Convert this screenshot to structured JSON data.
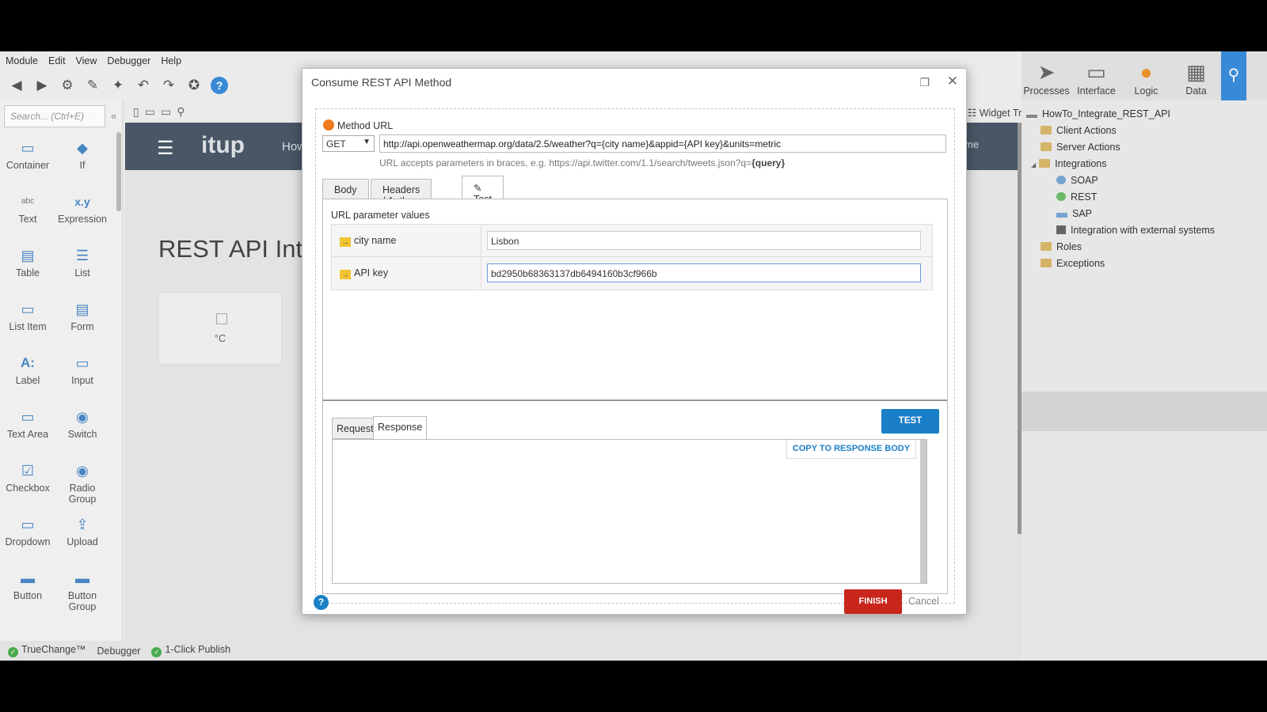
{
  "menu": [
    "Module",
    "Edit",
    "View",
    "Debugger",
    "Help"
  ],
  "main_tabs": [
    {
      "label": "Processes",
      "icon": "processes-icon"
    },
    {
      "label": "Interface",
      "icon": "interface-icon"
    },
    {
      "label": "Logic",
      "icon": "logic-icon"
    },
    {
      "label": "Data",
      "icon": "data-icon"
    }
  ],
  "toolbox": {
    "search_placeholder": "Search... (Ctrl+E)",
    "widgets": [
      "Container",
      "If",
      "Text",
      "Expression",
      "Table",
      "List",
      "List Item",
      "Form",
      "Label",
      "Input",
      "Text Area",
      "Switch",
      "Checkbox",
      "Radio Group",
      "Dropdown",
      "Upload",
      "Button",
      "Button Group"
    ],
    "widget_glyphs": [
      "abc",
      "x.y",
      "A:"
    ]
  },
  "canvas": {
    "widget_tree_label": "Widget Tree",
    "app_logo": "itup",
    "header_fragment": "How",
    "header_right": "me",
    "page_title": "REST API Int",
    "card_unit": "°C"
  },
  "tree": {
    "root": "HowTo_Integrate_REST_API",
    "items": [
      "Client Actions",
      "Server Actions",
      "Integrations",
      "SOAP",
      "REST",
      "SAP",
      "Integration with external systems",
      "Roles",
      "Exceptions"
    ]
  },
  "statusbar": [
    "TrueChange™",
    "Debugger",
    "1-Click Publish"
  ],
  "dialog": {
    "title": "Consume REST API Method",
    "method_url_label": "Method URL",
    "verb": "GET",
    "url": "http://api.openweathermap.org/data/2.5/weather?q={city name}&appid={API key}&units=metric",
    "url_hint": "URL accepts parameters in braces, e.g. https://api.twitter.com/1.1/search/tweets.json?q=",
    "url_hint_bold": "{query}",
    "tabs": [
      "Body",
      "Headers / Auth",
      "Test"
    ],
    "param_section_label": "URL parameter values",
    "params": [
      {
        "name": "city name",
        "value": "Lisbon"
      },
      {
        "name": "API key",
        "value": "bd2950b68363137db6494160b3cf966b"
      }
    ],
    "test_button": "TEST",
    "response_tabs": [
      "Request",
      "Response"
    ],
    "copy_button": "COPY TO RESPONSE BODY",
    "finish_button": "FINISH",
    "cancel_button": "Cancel"
  },
  "colors": {
    "accent": "#1a7fc7",
    "finish": "#c8261c",
    "app_header": "#4a5868",
    "orange": "#f07a1e"
  }
}
